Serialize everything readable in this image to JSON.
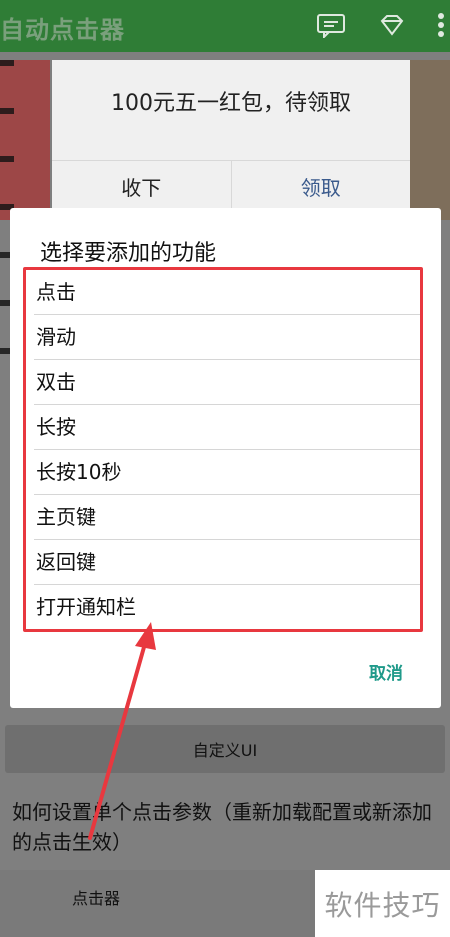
{
  "app": {
    "title": "自动点击器",
    "brand_color": "#2f7d36",
    "header_icons": [
      "chat-icon",
      "diamond-icon",
      "more-vertical-icon"
    ]
  },
  "promo": {
    "text": "100元五一红包，待领取",
    "dismiss_label": "收下",
    "claim_label": "领取",
    "claim_color": "#3a5a8c"
  },
  "dialog": {
    "title": "选择要添加的功能",
    "options": [
      {
        "label": "点击"
      },
      {
        "label": "滑动"
      },
      {
        "label": "双击"
      },
      {
        "label": "长按"
      },
      {
        "label": "长按10秒"
      },
      {
        "label": "主页键"
      },
      {
        "label": "返回键"
      },
      {
        "label": "打开通知栏"
      }
    ],
    "cancel_label": "取消",
    "accent_color": "#1f9a8a"
  },
  "main": {
    "custom_ui_label": "自定义UI",
    "help_text": "如何设置单个点击参数（重新加载配置或新添加的点击生效）"
  },
  "bottom_nav": {
    "label": "点击器"
  },
  "watermark": {
    "text": "软件技巧"
  },
  "annotation": {
    "highlight_color": "#e8383f"
  }
}
